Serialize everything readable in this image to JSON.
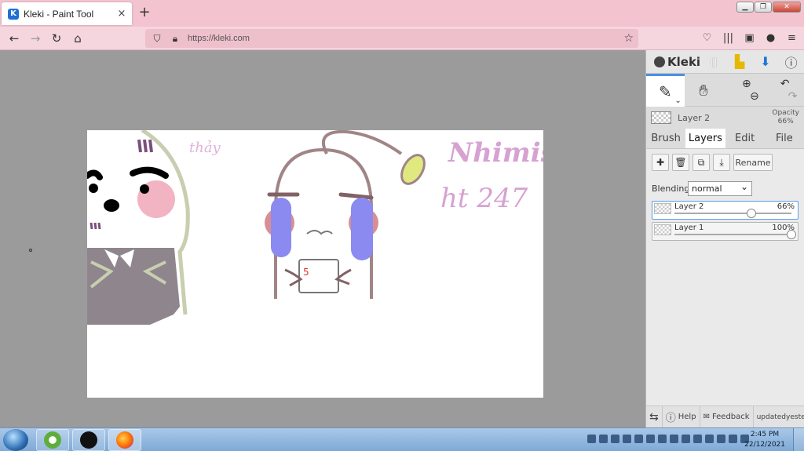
{
  "browser": {
    "tab_title": "Kleki - Paint Tool",
    "tab_close": "×",
    "new_tab": "+",
    "url": "https://kleki.com",
    "favicon_letter": "K"
  },
  "kleki": {
    "logo_text": "Kleki",
    "current_layer": "Layer 2",
    "opacity_label": "Opacity",
    "opacity_value": "66%",
    "tabs": [
      "Brush",
      "Layers",
      "Edit",
      "File"
    ],
    "active_tab": "Layers",
    "rename_label": "Rename",
    "blending_label": "Blending",
    "blending_value": "normal",
    "layers": [
      {
        "name": "Layer 2",
        "opacity": "66%",
        "level": 0.66,
        "active": true
      },
      {
        "name": "Layer 1",
        "opacity": "100%",
        "level": 1.0,
        "active": false
      }
    ],
    "footer": {
      "help": "Help",
      "feedback": "Feedback",
      "updated_line1": "updated",
      "updated_line2": "yesterday"
    }
  },
  "canvas": {
    "text_top_left": "thảy",
    "signature_line1": "Nhimisthy",
    "signature_line2": "ht 247",
    "paper_mark": "5"
  },
  "taskbar": {
    "time": "2:45 PM",
    "date": "22/12/2021"
  },
  "colors": {
    "browser_tab_bar": "#f3c4cf",
    "nav_bar": "#f5d6de",
    "panel_accent": "#4a90e2",
    "canvas_bg": "#9b9b9b"
  }
}
